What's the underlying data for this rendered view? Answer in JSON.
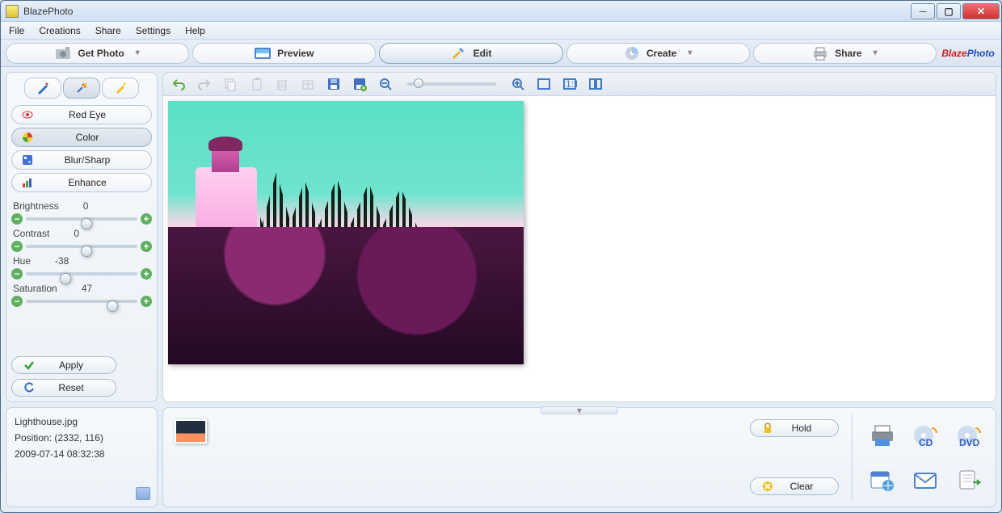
{
  "app": {
    "title": "BlazePhoto"
  },
  "menu": {
    "file": "File",
    "creations": "Creations",
    "share": "Share",
    "settings": "Settings",
    "help": "Help"
  },
  "tabs": {
    "getphoto": "Get Photo",
    "preview": "Preview",
    "edit": "Edit",
    "create": "Create",
    "share": "Share"
  },
  "brand": {
    "a": "Blaze",
    "b": "Photo"
  },
  "cats": {
    "redeye": "Red Eye",
    "color": "Color",
    "blur": "Blur/Sharp",
    "enhance": "Enhance"
  },
  "sliders": {
    "brightness": {
      "label": "Brightness",
      "value": "0",
      "pct": 50
    },
    "contrast": {
      "label": "Contrast",
      "value": "0",
      "pct": 50
    },
    "hue": {
      "label": "Hue",
      "value": "-38",
      "pct": 31
    },
    "saturation": {
      "label": "Saturation",
      "value": "47",
      "pct": 73
    }
  },
  "actions": {
    "apply": "Apply",
    "reset": "Reset"
  },
  "tray": {
    "hold": "Hold",
    "clear": "Clear"
  },
  "info": {
    "filename": "Lighthouse.jpg",
    "position": "Position: (2332, 116)",
    "timestamp": "2009-07-14 08:32:38"
  }
}
